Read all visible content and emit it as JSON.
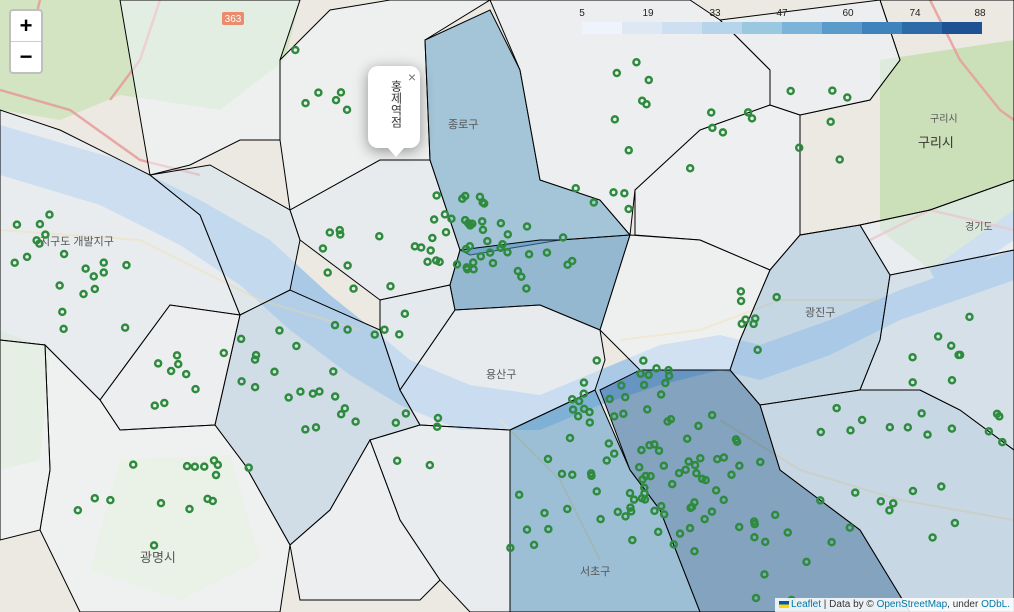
{
  "zoom": {
    "in_label": "+",
    "out_label": "−"
  },
  "legend": {
    "ticks": [
      "5",
      "19",
      "33",
      "47",
      "60",
      "74",
      "88"
    ],
    "colors": [
      "#eff3fb",
      "#dde8f4",
      "#cddff0",
      "#b6d4ea",
      "#9ac8e0",
      "#7cb3d8",
      "#5a9bcc",
      "#3f83bd",
      "#2c6aa8",
      "#1d5294"
    ]
  },
  "popup": {
    "text": "홍제역점",
    "close": "×"
  },
  "attribution": {
    "leaflet": "Leaflet",
    "sep1": " | Data by © ",
    "osm": "OpenStreetMap",
    "sep2": ", under ",
    "odbl": "ODbL."
  },
  "map_labels": {
    "highway_363": "363",
    "guri": "구리시",
    "guri_small": "구리시",
    "gwangmyeong": "광명시",
    "seocho": "서초구",
    "yongsan": "용산구",
    "jongno": "종로구",
    "gwangjin": "광진구",
    "gangseo": "지구도\n개발지구",
    "expressway_km": "경기도"
  },
  "colors": {
    "marker": "#2e8b3e",
    "boundary": "#000000",
    "river": "#aac9e6",
    "park": "#c8e0b5"
  }
}
